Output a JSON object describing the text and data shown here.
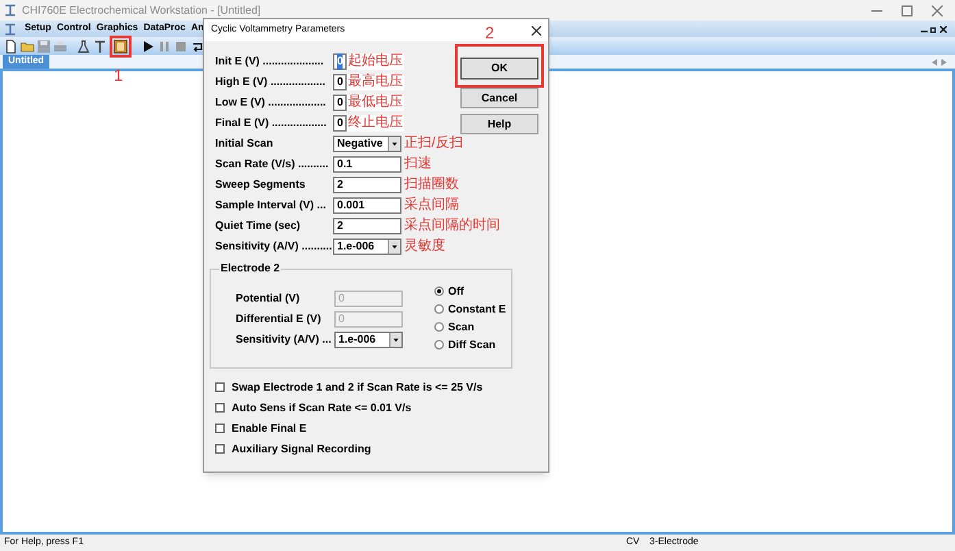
{
  "window": {
    "title": "CHI760E Electrochemical Workstation - [Untitled]"
  },
  "menu": [
    "Setup",
    "Control",
    "Graphics",
    "DataProc",
    "An"
  ],
  "toolbar": [
    {
      "kind": "new"
    },
    {
      "kind": "open"
    },
    {
      "kind": "save"
    },
    {
      "kind": "print"
    },
    {
      "kind": "separator"
    },
    {
      "kind": "technique"
    },
    {
      "kind": "text"
    },
    {
      "kind": "parameters",
      "callout": "1"
    },
    {
      "kind": "separator"
    },
    {
      "kind": "run"
    },
    {
      "kind": "pause"
    },
    {
      "kind": "stop"
    },
    {
      "kind": "repeat"
    }
  ],
  "tab": {
    "label": "Untitled"
  },
  "dialog": {
    "title": "Cyclic Voltammetry Parameters",
    "params": [
      {
        "kind": "short-field",
        "label": "Init E (V) ....................",
        "value": "0",
        "text_selected": true,
        "note": "起始电压"
      },
      {
        "kind": "short-field",
        "label": "High E (V) ..................",
        "value": "0",
        "text_selected": false,
        "note": "最高电压"
      },
      {
        "kind": "short-field",
        "label": "Low E (V) ...................",
        "value": "0",
        "text_selected": false,
        "note": "最低电压"
      },
      {
        "kind": "short-field",
        "label": "Final E (V) ..................",
        "value": "0",
        "text_selected": false,
        "note": "终止电压"
      },
      {
        "kind": "dropdown",
        "label": "Initial Scan",
        "value": "Negative",
        "text_selected": false,
        "note": "正扫/反扫"
      },
      {
        "kind": "field",
        "label": "Scan Rate (V/s) ..........",
        "value": "0.1",
        "text_selected": false,
        "note": "扫速"
      },
      {
        "kind": "field",
        "label": "Sweep Segments",
        "value": "2",
        "text_selected": false,
        "note": "扫描圈数"
      },
      {
        "kind": "field",
        "label": "Sample Interval (V) ...",
        "value": "0.001",
        "text_selected": false,
        "note": "采点间隔"
      },
      {
        "kind": "field",
        "label": "Quiet Time (sec)",
        "value": "2",
        "text_selected": false,
        "note": "采点间隔的时间"
      },
      {
        "kind": "dropdown",
        "label": "Sensitivity (A/V) ..........",
        "value": "1.e-006",
        "text_selected": false,
        "note": "灵敏度"
      }
    ],
    "buttons": [
      {
        "label": "OK",
        "callout": "2"
      },
      {
        "label": "Cancel"
      },
      {
        "label": "Help"
      }
    ],
    "electrode2": {
      "title": "Electrode 2",
      "fields": [
        {
          "kind": "field",
          "label": "Potential (V)",
          "value": "0",
          "disabled": true
        },
        {
          "kind": "field",
          "label": "Differential E (V)",
          "value": "0",
          "disabled": true
        },
        {
          "kind": "dropdown",
          "label": "Sensitivity (A/V) ...",
          "value": "1.e-006",
          "disabled": false
        }
      ],
      "options": [
        {
          "label": "Off",
          "selected": true
        },
        {
          "label": "Constant E",
          "selected": false
        },
        {
          "label": "Scan",
          "selected": false
        },
        {
          "label": "Diff Scan",
          "selected": false
        }
      ]
    },
    "checkboxes": [
      {
        "label": "Swap Electrode 1 and 2 if Scan Rate is <= 25 V/s",
        "checked": false
      },
      {
        "label": "Auto Sens if Scan Rate <= 0.01 V/s",
        "checked": false
      },
      {
        "label": "Enable Final E",
        "checked": false
      },
      {
        "label": "Auxiliary Signal Recording",
        "checked": false
      }
    ]
  },
  "status_bar": [
    "For Help, press F1",
    "CV",
    "3-Electrode"
  ]
}
